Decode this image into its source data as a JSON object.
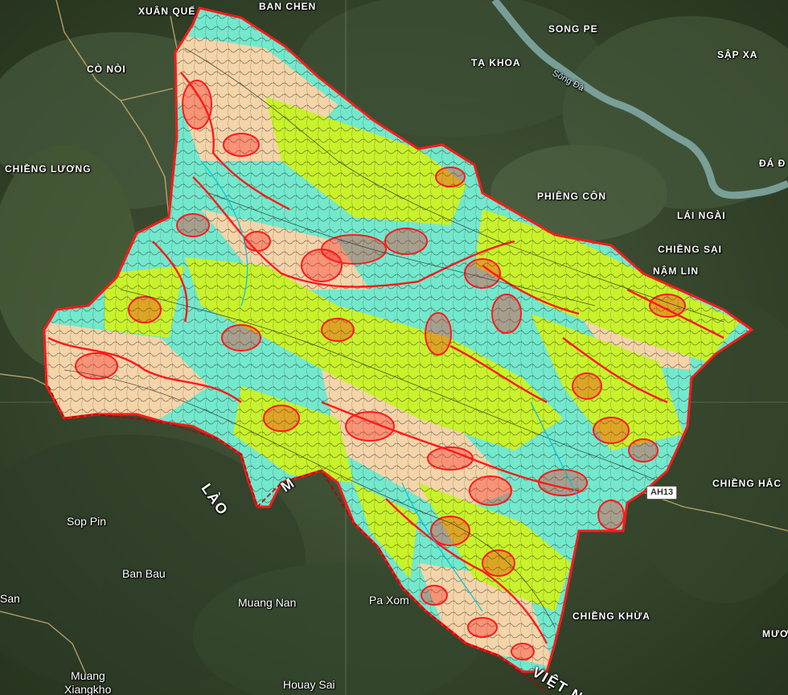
{
  "map": {
    "place_labels": [
      {
        "id": "xuan-que",
        "text": "XUÂN QUẾ"
      },
      {
        "id": "ban-chen",
        "text": "BAN CHEN"
      },
      {
        "id": "song-pe",
        "text": "SONG PE"
      },
      {
        "id": "sap-xa",
        "text": "SẬP XA"
      },
      {
        "id": "ta-khoa",
        "text": "TẠ KHOA"
      },
      {
        "id": "co-noi",
        "text": "CÒ NÒI"
      },
      {
        "id": "chieng-luong",
        "text": "CHIỀNG LƯƠNG"
      },
      {
        "id": "da-dong",
        "text": "ĐÁ Đ"
      },
      {
        "id": "phieng-con",
        "text": "PHIÊNG CÔN"
      },
      {
        "id": "lai-ngai",
        "text": "LÁI NGÀI"
      },
      {
        "id": "chieng-sai",
        "text": "CHIỀNG SẠI"
      },
      {
        "id": "nam-lin",
        "text": "NẬM LIN"
      },
      {
        "id": "chieng-hac",
        "text": "CHIỀNG HẮC"
      },
      {
        "id": "chieng-khua",
        "text": "CHIỀNG KHỪA"
      },
      {
        "id": "muo",
        "text": "MƯƠ"
      }
    ],
    "foreign_labels": [
      {
        "id": "sop-pin",
        "text": "Sop Pin"
      },
      {
        "id": "ban-bau",
        "text": "Ban Bau"
      },
      {
        "id": "san",
        "text": "San"
      },
      {
        "id": "muang-nan",
        "text": "Muang Nan"
      },
      {
        "id": "pa-xom",
        "text": "Pa Xom"
      },
      {
        "id": "muang",
        "text": "Muang"
      },
      {
        "id": "xiangkho",
        "text": "Xiangkho"
      },
      {
        "id": "houay-sai",
        "text": "Houay Sai"
      }
    ],
    "river_label": "Sông Đà",
    "border_labels": {
      "lao": "LÀO",
      "m": "M",
      "viet_nam": "VIỆT NAM"
    },
    "road_shield": "AH13",
    "colors": {
      "satellite": "#3a4c33",
      "forest_dark": "#2c3a27",
      "river": "#7fa7a3",
      "region_yellow_green": "#c8f22a",
      "region_cyan": "#72e8cc",
      "region_peach": "#f4d4a8",
      "boundary_red": "#ff1a1a",
      "grid_line": "#d8d8d8"
    }
  }
}
